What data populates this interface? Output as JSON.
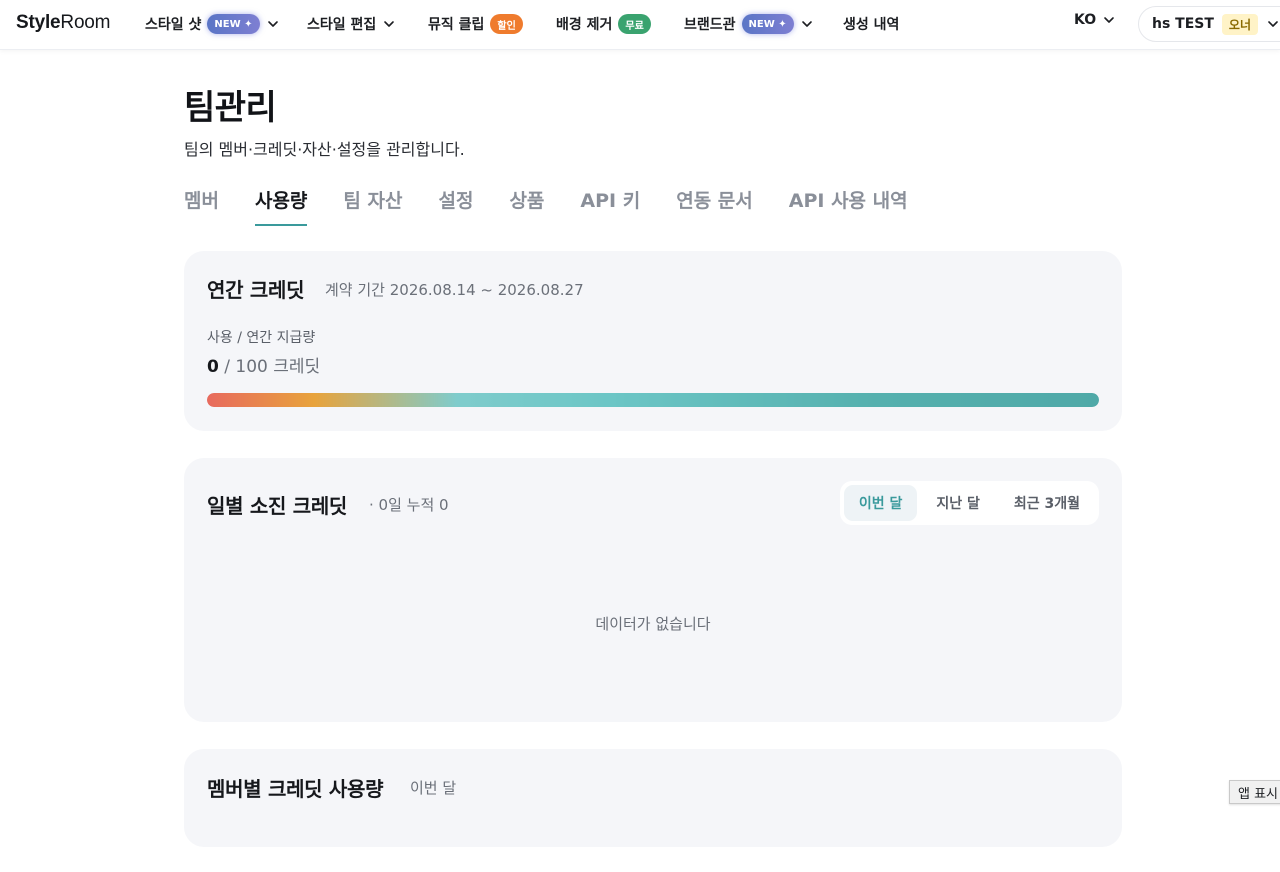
{
  "brand": {
    "bold": "Style",
    "light": "Room"
  },
  "nav": {
    "items": [
      {
        "label": "스타일 샷",
        "badge": "NEW ✦",
        "badge_type": "new",
        "dropdown": true
      },
      {
        "label": "스타일 편집",
        "badge": "",
        "dropdown": true
      },
      {
        "label": "뮤직 클립",
        "badge": "할인",
        "badge_type": "sale",
        "dropdown": false
      },
      {
        "label": "배경 제거",
        "badge": "무료",
        "badge_type": "free",
        "dropdown": false
      },
      {
        "label": "브랜드관",
        "badge": "NEW ✦",
        "badge_type": "new",
        "dropdown": true
      },
      {
        "label": "생성 내역",
        "badge": "",
        "dropdown": false
      }
    ],
    "language": "KO",
    "account": {
      "name": "hs TEST",
      "role": "오너"
    }
  },
  "page": {
    "title": "팀관리",
    "subtitle": "팀의 멤버·크레딧·자산·설정을 관리합니다."
  },
  "tabs": [
    "멤버",
    "사용량",
    "팀 자산",
    "설정",
    "상품",
    "API 키",
    "연동 문서",
    "API 사용 내역"
  ],
  "active_tab": "사용량",
  "annual_credit": {
    "title": "연간 크레딧",
    "period": "계약 기간 2026.08.14 ~ 2026.08.27",
    "usage_label": "사용 / 연간 지급량",
    "used": "0",
    "total_text": "/ 100 크레딧",
    "used_value": 0,
    "total_value": 100
  },
  "daily_burn": {
    "title": "일별 소진 크레딧",
    "summary": "· 0일 누적 0",
    "filters": [
      "이번 달",
      "지난 달",
      "최근 3개월"
    ],
    "active_filter": "이번 달",
    "empty_text": "데이터가 없습니다"
  },
  "member_usage": {
    "title": "멤버별 크레딧 사용량",
    "period": "이번 달"
  },
  "floating_button": "앱 표시",
  "colors": {
    "accent": "#3a9a9c",
    "card_bg": "#f5f6f9",
    "badge_new": "#6b78cc",
    "badge_sale": "#ef7b2d",
    "badge_free": "#3aa36f",
    "owner_badge": "#fff3c7"
  }
}
